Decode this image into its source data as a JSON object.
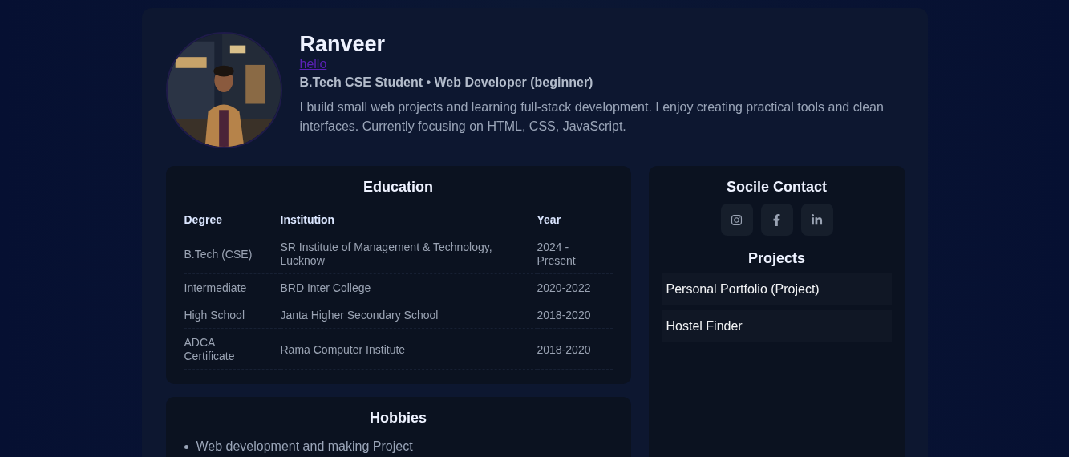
{
  "profile": {
    "name": "Ranveer",
    "link": "hello",
    "headline": "B.Tech CSE Student • Web Developer (beginner)",
    "bio": "I build small web projects and learning full-stack development. I enjoy creating practical tools and clean interfaces. Currently focusing on HTML, CSS, JavaScript."
  },
  "education": {
    "title": "Education",
    "columns": [
      "Degree",
      "Institution",
      "Year"
    ],
    "rows": [
      [
        "B.Tech (CSE)",
        "SR Institute of Management & Technology, Lucknow",
        "2024 - Present"
      ],
      [
        "Intermediate",
        "BRD Inter College",
        "2020-2022"
      ],
      [
        "High School",
        "Janta Higher Secondary School",
        "2018-2020"
      ],
      [
        "ADCA Certificate",
        "Rama Computer Institute",
        "2018-2020"
      ]
    ]
  },
  "hobbies": {
    "title": "Hobbies",
    "items": [
      "Web development and making Project"
    ]
  },
  "social": {
    "title": "Socile Contact",
    "links": [
      {
        "kind": "instagram"
      },
      {
        "kind": "facebook"
      },
      {
        "kind": "linkedin"
      }
    ]
  },
  "projects": {
    "title": "Projects",
    "items": [
      "Personal Portfolio (Project)",
      "Hostel Finder"
    ]
  }
}
